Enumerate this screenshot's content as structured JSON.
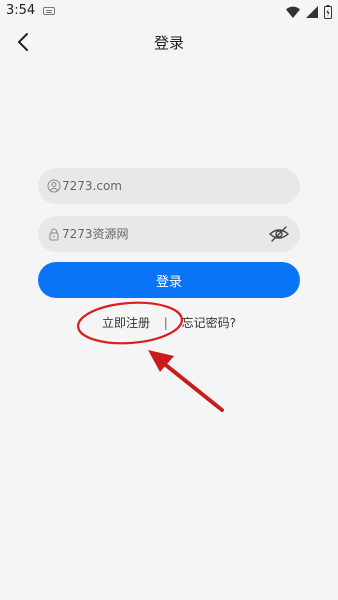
{
  "status_bar": {
    "time": "3:54"
  },
  "header": {
    "title": "登录"
  },
  "form": {
    "username": {
      "placeholder": "7273.com"
    },
    "password": {
      "placeholder": "7273资源网"
    },
    "login_button_label": "登录"
  },
  "links": {
    "register": "立即注册",
    "separator": "|",
    "forgot": "忘记密码?"
  },
  "colors": {
    "primary": "#0a74f6",
    "background": "#f5f5f5",
    "field": "#e8e8e8",
    "annotation": "#d81e1e"
  },
  "icons": [
    "back-arrow-icon",
    "user-icon",
    "lock-icon",
    "eye-off-icon",
    "wifi-icon",
    "signal-icon",
    "battery-icon",
    "keyboard-icon"
  ]
}
